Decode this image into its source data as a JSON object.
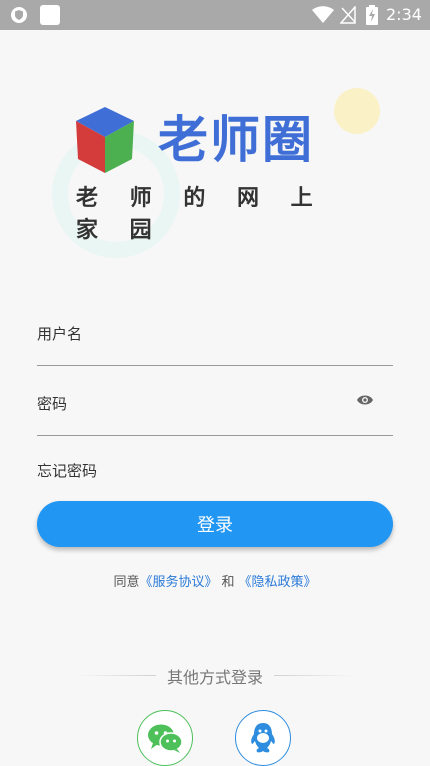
{
  "status_bar": {
    "time": "2:34",
    "icons": [
      "shield-icon",
      "notification-square-icon",
      "wifi-icon",
      "no-signal-icon",
      "battery-charging-icon"
    ]
  },
  "brand": {
    "name": "老师圈",
    "slogan": "老 师 的 网 上 家 园",
    "colors": {
      "blue": "#3f6fd6",
      "cube_red": "#d43c3c",
      "cube_green": "#4caf50",
      "cube_blue": "#3f6fd6"
    }
  },
  "form": {
    "username_placeholder": "用户名",
    "password_placeholder": "密码",
    "password_toggle_icon": "eye-icon",
    "forgot_password": "忘记密码",
    "login_button": "登录"
  },
  "agreement": {
    "prefix": "同意",
    "service_link": "《服务协议》",
    "and": "和",
    "privacy_link": "《隐私政策》"
  },
  "other_login": {
    "title": "其他方式登录",
    "providers": [
      "wechat-icon",
      "qq-icon"
    ]
  },
  "colors": {
    "accent": "#2196f3",
    "link": "#2a7ad8",
    "wechat": "#4dc05a",
    "qq": "#2e8ddf"
  }
}
